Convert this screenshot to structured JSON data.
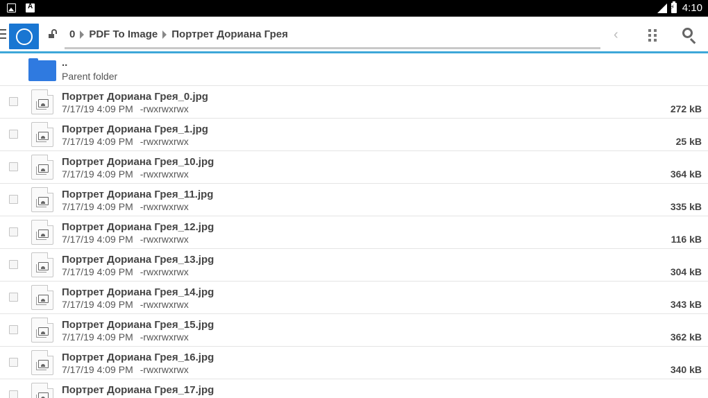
{
  "status_bar": {
    "notification_icons": [
      "image-icon",
      "a-icon"
    ],
    "a_icon_text": "A",
    "time": "4:10"
  },
  "toolbar": {
    "breadcrumbs": [
      "0",
      "PDF To Image",
      "Портрет Дориана Грея"
    ],
    "accent_color": "#3da7d8",
    "logo_color": "#1976d2"
  },
  "parent": {
    "dots": "..",
    "label": "Parent folder",
    "folder_color": "#2f7ae0"
  },
  "files": [
    {
      "name": "Портрет Дориана Грея_0.jpg",
      "date": "7/17/19 4:09 PM",
      "perm": "-rwxrwxrwx",
      "size": "272 kB"
    },
    {
      "name": "Портрет Дориана Грея_1.jpg",
      "date": "7/17/19 4:09 PM",
      "perm": "-rwxrwxrwx",
      "size": "25 kB"
    },
    {
      "name": "Портрет Дориана Грея_10.jpg",
      "date": "7/17/19 4:09 PM",
      "perm": "-rwxrwxrwx",
      "size": "364 kB"
    },
    {
      "name": "Портрет Дориана Грея_11.jpg",
      "date": "7/17/19 4:09 PM",
      "perm": "-rwxrwxrwx",
      "size": "335 kB"
    },
    {
      "name": "Портрет Дориана Грея_12.jpg",
      "date": "7/17/19 4:09 PM",
      "perm": "-rwxrwxrwx",
      "size": "116 kB"
    },
    {
      "name": "Портрет Дориана Грея_13.jpg",
      "date": "7/17/19 4:09 PM",
      "perm": "-rwxrwxrwx",
      "size": "304 kB"
    },
    {
      "name": "Портрет Дориана Грея_14.jpg",
      "date": "7/17/19 4:09 PM",
      "perm": "-rwxrwxrwx",
      "size": "343 kB"
    },
    {
      "name": "Портрет Дориана Грея_15.jpg",
      "date": "7/17/19 4:09 PM",
      "perm": "-rwxrwxrwx",
      "size": "362 kB"
    },
    {
      "name": "Портрет Дориана Грея_16.jpg",
      "date": "7/17/19 4:09 PM",
      "perm": "-rwxrwxrwx",
      "size": "340 kB"
    },
    {
      "name": "Портрет Дориана Грея_17.jpg",
      "date": "",
      "perm": "",
      "size": ""
    }
  ]
}
